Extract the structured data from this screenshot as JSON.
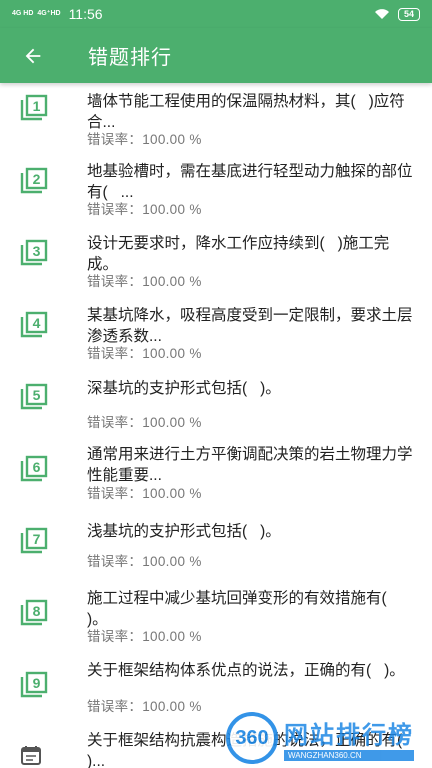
{
  "status_bar": {
    "signal_1": "4G HD",
    "signal_2": "4G⁺HD",
    "time": "11:56",
    "battery": "54"
  },
  "app_bar": {
    "title": "错题排行",
    "back_icon": "arrow-left-icon"
  },
  "items": [
    {
      "num": "1",
      "title": "墙体节能工程使用的保温隔热材料，其(   )应符合...",
      "rate": "错误率：100.00 %"
    },
    {
      "num": "2",
      "title": "地基验槽时，需在基底进行轻型动力触探的部位有(   ...",
      "rate": "错误率：100.00 %"
    },
    {
      "num": "3",
      "title": "设计无要求时，降水工作应持续到(   )施工完成。",
      "rate": "错误率：100.00 %"
    },
    {
      "num": "4",
      "title": "某基坑降水，吸程高度受到一定限制，要求土层渗透系数...",
      "rate": "错误率：100.00 %"
    },
    {
      "num": "5",
      "title": "深基坑的支护形式包括(   )。",
      "rate": "错误率：100.00 %"
    },
    {
      "num": "6",
      "title": "通常用来进行土方平衡调配决策的岩土物理力学性能重要...",
      "rate": "错误率：100.00 %"
    },
    {
      "num": "7",
      "title": "浅基坑的支护形式包括(   )。",
      "rate": "错误率：100.00 %"
    },
    {
      "num": "8",
      "title": "施工过程中减少基坑回弹变形的有效措施有(   )。",
      "rate": "错误率：100.00 %"
    },
    {
      "num": "9",
      "title": "关于框架结构体系优点的说法，正确的有(   )。",
      "rate": "错误率：100.00 %"
    },
    {
      "num": "",
      "title": "关于框架结构抗震构造措施的说法，正确的有(   )...",
      "rate": ""
    }
  ],
  "watermark": {
    "logo": "360",
    "main": "网站排行榜",
    "sub": "WANGZHAN360.CN"
  },
  "colors": {
    "primary": "#4CAF6E",
    "title_text": "#222222",
    "rate_text": "#777777"
  }
}
